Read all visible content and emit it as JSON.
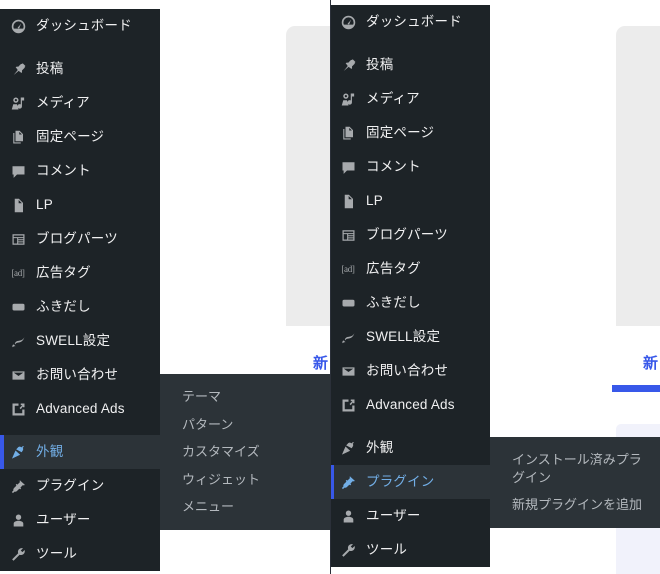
{
  "app": {
    "name": "WordPress Admin",
    "colors": {
      "sidebar_bg": "#1d2327",
      "sidebar_active_bg": "#2c3338",
      "accent_blue": "#3858e9",
      "active_text": "#72aee6",
      "label_text": "#f0f0f1",
      "submenu_text": "#b4b9be",
      "content_card": "#ececec",
      "content_card_alt": "#f1f2fb"
    }
  },
  "sidebar": {
    "items": [
      {
        "label": "ダッシュボード",
        "icon": "dashboard-icon",
        "sep_after": true
      },
      {
        "label": "投稿",
        "icon": "pin-icon",
        "sep_after": false
      },
      {
        "label": "メディア",
        "icon": "media-icon",
        "sep_after": false
      },
      {
        "label": "固定ページ",
        "icon": "pages-icon",
        "sep_after": false
      },
      {
        "label": "コメント",
        "icon": "comment-icon",
        "sep_after": false
      },
      {
        "label": "LP",
        "icon": "page-icon",
        "sep_after": false
      },
      {
        "label": "ブログパーツ",
        "icon": "blogparts-icon",
        "sep_after": false
      },
      {
        "label": "広告タグ",
        "icon": "ad-tag-icon",
        "sep_after": false
      },
      {
        "label": "ふきだし",
        "icon": "balloon-icon",
        "sep_after": false
      },
      {
        "label": "SWELL設定",
        "icon": "swell-icon",
        "sep_after": false
      },
      {
        "label": "お問い合わせ",
        "icon": "mail-icon",
        "sep_after": false
      },
      {
        "label": "Advanced Ads",
        "icon": "advanced-ads-icon",
        "sep_after": true
      },
      {
        "label": "外観",
        "icon": "appearance-icon",
        "sep_after": false
      },
      {
        "label": "プラグイン",
        "icon": "plugins-icon",
        "sep_after": false
      },
      {
        "label": "ユーザー",
        "icon": "users-icon",
        "sep_after": false
      },
      {
        "label": "ツール",
        "icon": "tools-icon",
        "sep_after": false
      }
    ]
  },
  "panel_left": {
    "active_item_index": 12,
    "active_item_label": "外観",
    "submenu": {
      "items": [
        "テーマ",
        "パターン",
        "カスタマイズ",
        "ウィジェット",
        "メニュー"
      ]
    },
    "content": {
      "heading": "新"
    }
  },
  "panel_right": {
    "active_item_index": 13,
    "active_item_label": "プラグイン",
    "submenu": {
      "items": [
        "インストール済みプラグイン",
        "新規プラグインを追加"
      ]
    },
    "content": {
      "heading": "新"
    }
  }
}
